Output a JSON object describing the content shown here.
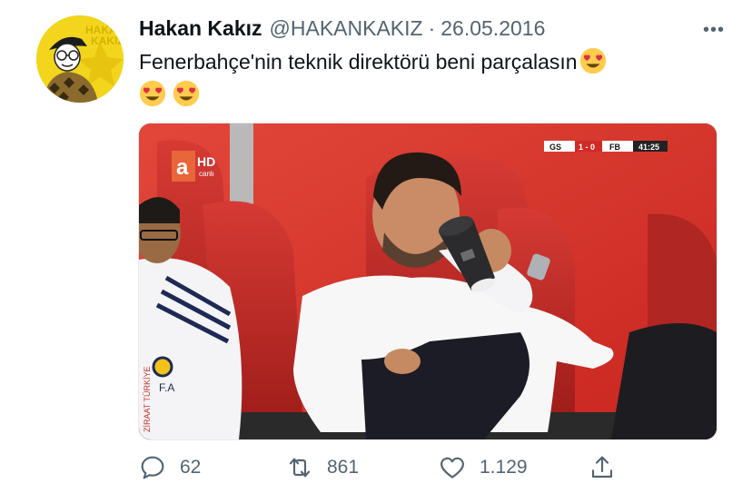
{
  "user": {
    "display_name": "Hakan Kakız",
    "handle": "@HAKANKAKIZ",
    "separator": "·",
    "date": "26.05.2016",
    "avatar_text_line1": "HAKAN",
    "avatar_text_line2": "KAKIZ"
  },
  "tweet": {
    "text": "Fenerbahçe'nin teknik direktörü beni parçalasın",
    "emojis": [
      "smiling-face-with-heart-eyes",
      "smiling-face-with-heart-eyes",
      "smiling-face-with-heart-eyes"
    ]
  },
  "media": {
    "channel_logo": "a",
    "channel_badge": "HD",
    "channel_sub": "canlı",
    "score_home": "GS",
    "score": "1 - 0",
    "score_away": "FB",
    "clock": "41:25",
    "kit_text": "F.A",
    "banner_text": "ZİRAAT TÜRKİYE"
  },
  "actions": {
    "reply_count": "62",
    "retweet_count": "861",
    "like_count": "1.129"
  },
  "more_label": "•••",
  "colors": {
    "text": "#0f1419",
    "secondary": "#536471",
    "seat_red": "#d32f2f"
  }
}
